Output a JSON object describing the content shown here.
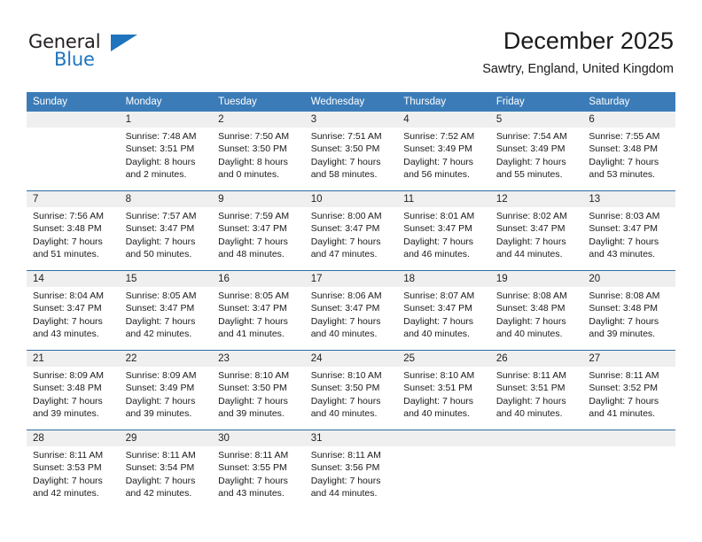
{
  "brand": {
    "name_part1": "General",
    "name_part2": "Blue",
    "triangle_color": "#1f74bd",
    "text_color": "#231f20"
  },
  "header": {
    "month_title": "December 2025",
    "location": "Sawtry, England, United Kingdom"
  },
  "theme": {
    "header_blue": "#3b7cb8",
    "row_border_blue": "#2e6da4",
    "daynum_band": "#efefef",
    "cell_background": "#ffffff",
    "text_color": "#1a1a1a"
  },
  "columns": [
    "Sunday",
    "Monday",
    "Tuesday",
    "Wednesday",
    "Thursday",
    "Friday",
    "Saturday"
  ],
  "weeks": [
    {
      "days": [
        {
          "num": "",
          "sunrise": "",
          "sunset": "",
          "daylight_line1": "",
          "daylight_line2": ""
        },
        {
          "num": "1",
          "sunrise": "Sunrise: 7:48 AM",
          "sunset": "Sunset: 3:51 PM",
          "daylight_line1": "Daylight: 8 hours",
          "daylight_line2": "and 2 minutes."
        },
        {
          "num": "2",
          "sunrise": "Sunrise: 7:50 AM",
          "sunset": "Sunset: 3:50 PM",
          "daylight_line1": "Daylight: 8 hours",
          "daylight_line2": "and 0 minutes."
        },
        {
          "num": "3",
          "sunrise": "Sunrise: 7:51 AM",
          "sunset": "Sunset: 3:50 PM",
          "daylight_line1": "Daylight: 7 hours",
          "daylight_line2": "and 58 minutes."
        },
        {
          "num": "4",
          "sunrise": "Sunrise: 7:52 AM",
          "sunset": "Sunset: 3:49 PM",
          "daylight_line1": "Daylight: 7 hours",
          "daylight_line2": "and 56 minutes."
        },
        {
          "num": "5",
          "sunrise": "Sunrise: 7:54 AM",
          "sunset": "Sunset: 3:49 PM",
          "daylight_line1": "Daylight: 7 hours",
          "daylight_line2": "and 55 minutes."
        },
        {
          "num": "6",
          "sunrise": "Sunrise: 7:55 AM",
          "sunset": "Sunset: 3:48 PM",
          "daylight_line1": "Daylight: 7 hours",
          "daylight_line2": "and 53 minutes."
        }
      ]
    },
    {
      "days": [
        {
          "num": "7",
          "sunrise": "Sunrise: 7:56 AM",
          "sunset": "Sunset: 3:48 PM",
          "daylight_line1": "Daylight: 7 hours",
          "daylight_line2": "and 51 minutes."
        },
        {
          "num": "8",
          "sunrise": "Sunrise: 7:57 AM",
          "sunset": "Sunset: 3:47 PM",
          "daylight_line1": "Daylight: 7 hours",
          "daylight_line2": "and 50 minutes."
        },
        {
          "num": "9",
          "sunrise": "Sunrise: 7:59 AM",
          "sunset": "Sunset: 3:47 PM",
          "daylight_line1": "Daylight: 7 hours",
          "daylight_line2": "and 48 minutes."
        },
        {
          "num": "10",
          "sunrise": "Sunrise: 8:00 AM",
          "sunset": "Sunset: 3:47 PM",
          "daylight_line1": "Daylight: 7 hours",
          "daylight_line2": "and 47 minutes."
        },
        {
          "num": "11",
          "sunrise": "Sunrise: 8:01 AM",
          "sunset": "Sunset: 3:47 PM",
          "daylight_line1": "Daylight: 7 hours",
          "daylight_line2": "and 46 minutes."
        },
        {
          "num": "12",
          "sunrise": "Sunrise: 8:02 AM",
          "sunset": "Sunset: 3:47 PM",
          "daylight_line1": "Daylight: 7 hours",
          "daylight_line2": "and 44 minutes."
        },
        {
          "num": "13",
          "sunrise": "Sunrise: 8:03 AM",
          "sunset": "Sunset: 3:47 PM",
          "daylight_line1": "Daylight: 7 hours",
          "daylight_line2": "and 43 minutes."
        }
      ]
    },
    {
      "days": [
        {
          "num": "14",
          "sunrise": "Sunrise: 8:04 AM",
          "sunset": "Sunset: 3:47 PM",
          "daylight_line1": "Daylight: 7 hours",
          "daylight_line2": "and 43 minutes."
        },
        {
          "num": "15",
          "sunrise": "Sunrise: 8:05 AM",
          "sunset": "Sunset: 3:47 PM",
          "daylight_line1": "Daylight: 7 hours",
          "daylight_line2": "and 42 minutes."
        },
        {
          "num": "16",
          "sunrise": "Sunrise: 8:05 AM",
          "sunset": "Sunset: 3:47 PM",
          "daylight_line1": "Daylight: 7 hours",
          "daylight_line2": "and 41 minutes."
        },
        {
          "num": "17",
          "sunrise": "Sunrise: 8:06 AM",
          "sunset": "Sunset: 3:47 PM",
          "daylight_line1": "Daylight: 7 hours",
          "daylight_line2": "and 40 minutes."
        },
        {
          "num": "18",
          "sunrise": "Sunrise: 8:07 AM",
          "sunset": "Sunset: 3:47 PM",
          "daylight_line1": "Daylight: 7 hours",
          "daylight_line2": "and 40 minutes."
        },
        {
          "num": "19",
          "sunrise": "Sunrise: 8:08 AM",
          "sunset": "Sunset: 3:48 PM",
          "daylight_line1": "Daylight: 7 hours",
          "daylight_line2": "and 40 minutes."
        },
        {
          "num": "20",
          "sunrise": "Sunrise: 8:08 AM",
          "sunset": "Sunset: 3:48 PM",
          "daylight_line1": "Daylight: 7 hours",
          "daylight_line2": "and 39 minutes."
        }
      ]
    },
    {
      "days": [
        {
          "num": "21",
          "sunrise": "Sunrise: 8:09 AM",
          "sunset": "Sunset: 3:48 PM",
          "daylight_line1": "Daylight: 7 hours",
          "daylight_line2": "and 39 minutes."
        },
        {
          "num": "22",
          "sunrise": "Sunrise: 8:09 AM",
          "sunset": "Sunset: 3:49 PM",
          "daylight_line1": "Daylight: 7 hours",
          "daylight_line2": "and 39 minutes."
        },
        {
          "num": "23",
          "sunrise": "Sunrise: 8:10 AM",
          "sunset": "Sunset: 3:50 PM",
          "daylight_line1": "Daylight: 7 hours",
          "daylight_line2": "and 39 minutes."
        },
        {
          "num": "24",
          "sunrise": "Sunrise: 8:10 AM",
          "sunset": "Sunset: 3:50 PM",
          "daylight_line1": "Daylight: 7 hours",
          "daylight_line2": "and 40 minutes."
        },
        {
          "num": "25",
          "sunrise": "Sunrise: 8:10 AM",
          "sunset": "Sunset: 3:51 PM",
          "daylight_line1": "Daylight: 7 hours",
          "daylight_line2": "and 40 minutes."
        },
        {
          "num": "26",
          "sunrise": "Sunrise: 8:11 AM",
          "sunset": "Sunset: 3:51 PM",
          "daylight_line1": "Daylight: 7 hours",
          "daylight_line2": "and 40 minutes."
        },
        {
          "num": "27",
          "sunrise": "Sunrise: 8:11 AM",
          "sunset": "Sunset: 3:52 PM",
          "daylight_line1": "Daylight: 7 hours",
          "daylight_line2": "and 41 minutes."
        }
      ]
    },
    {
      "days": [
        {
          "num": "28",
          "sunrise": "Sunrise: 8:11 AM",
          "sunset": "Sunset: 3:53 PM",
          "daylight_line1": "Daylight: 7 hours",
          "daylight_line2": "and 42 minutes."
        },
        {
          "num": "29",
          "sunrise": "Sunrise: 8:11 AM",
          "sunset": "Sunset: 3:54 PM",
          "daylight_line1": "Daylight: 7 hours",
          "daylight_line2": "and 42 minutes."
        },
        {
          "num": "30",
          "sunrise": "Sunrise: 8:11 AM",
          "sunset": "Sunset: 3:55 PM",
          "daylight_line1": "Daylight: 7 hours",
          "daylight_line2": "and 43 minutes."
        },
        {
          "num": "31",
          "sunrise": "Sunrise: 8:11 AM",
          "sunset": "Sunset: 3:56 PM",
          "daylight_line1": "Daylight: 7 hours",
          "daylight_line2": "and 44 minutes."
        },
        {
          "num": "",
          "sunrise": "",
          "sunset": "",
          "daylight_line1": "",
          "daylight_line2": ""
        },
        {
          "num": "",
          "sunrise": "",
          "sunset": "",
          "daylight_line1": "",
          "daylight_line2": ""
        },
        {
          "num": "",
          "sunrise": "",
          "sunset": "",
          "daylight_line1": "",
          "daylight_line2": ""
        }
      ]
    }
  ]
}
